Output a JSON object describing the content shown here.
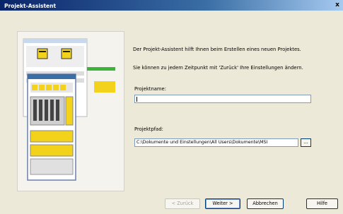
{
  "window": {
    "title": "Projekt-Assistent",
    "close_glyph": "x"
  },
  "main": {
    "intro_line1": "Der Projekt-Assistent hilft Ihnen beim Erstellen eines neuen Projektes.",
    "intro_line2": "Sie können zu jedem Zeitpunkt mit 'Zurück' Ihre Einstellungen ändern.",
    "project_name_label": "Projektname:",
    "project_name_value": "",
    "project_path_label": "Projektpfad:",
    "project_path_value": "C:\\Dokumente und Einstellungen\\All Users\\Dokumente\\MSI",
    "browse_label": "..."
  },
  "buttons": {
    "back": "< Zurück",
    "next": "Weiter >",
    "cancel": "Abbrechen",
    "help": "Hilfe"
  },
  "colors": {
    "titlebar_start": "#0a246a",
    "titlebar_end": "#a6caf0",
    "dialog_bg": "#ece9d8",
    "accent_green": "#3cb43c",
    "accent_yellow": "#f2d21a"
  },
  "icons": {
    "illustration": "project-wizard-illustration"
  }
}
